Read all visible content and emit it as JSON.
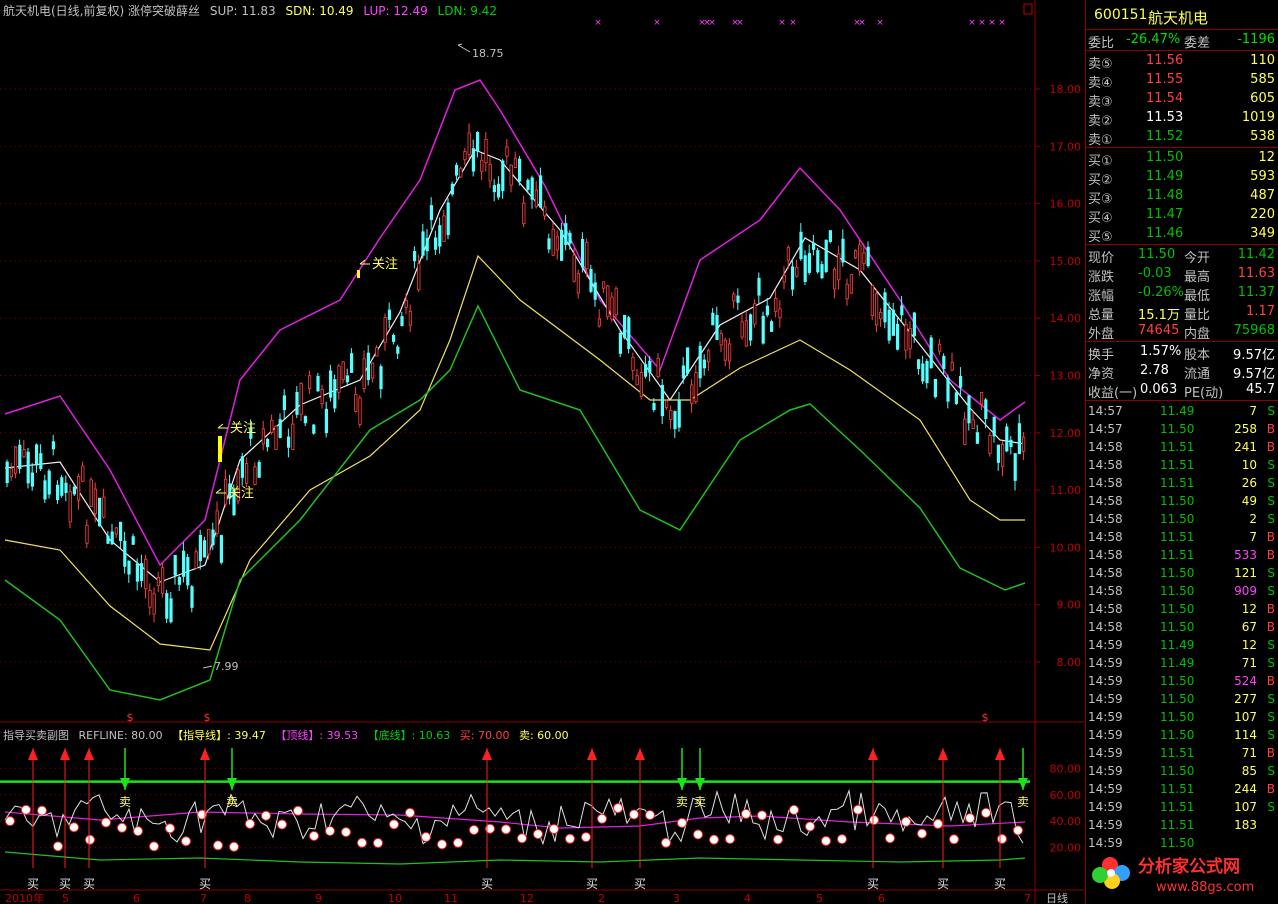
{
  "chart_header": {
    "title": "航天机电(日线,前复权) 涨停突破薛丝",
    "sup": "SUP: 11.83",
    "sdn": "SDN: 10.49",
    "lup": "LUP: 12.49",
    "ldn": "LDN: 9.42"
  },
  "sub_header": {
    "title": "指导买卖副图",
    "refline": "REFLINE: 80.00",
    "guide": "【指导线】: 39.47",
    "top": "【顶线】: 39.53",
    "bottom": "【底线】: 10.63",
    "buy": "买: 70.00",
    "sell": "卖: 60.00"
  },
  "price_axis": [
    "18.00",
    "17.00",
    "16.00",
    "15.00",
    "14.00",
    "13.00",
    "12.00",
    "11.00",
    "10.00",
    "9.00",
    "8.00"
  ],
  "sub_axis": [
    "80.00",
    "60.00",
    "40.00",
    "20.00"
  ],
  "annotations": {
    "high": "18.75",
    "low": "7.99",
    "watch": "关注",
    "buy": "买",
    "sell": "卖",
    "dollar": "$"
  },
  "date_axis": [
    "2010年",
    "5",
    "6",
    "7",
    "8",
    "9",
    "10",
    "11",
    "12",
    "2",
    "3",
    "4",
    "5",
    "6",
    "7"
  ],
  "period_tab": "日线",
  "stock": {
    "code": "600151",
    "name": "航天机电",
    "weibi_label": "委比",
    "weibi": "-26.47%",
    "weicha_label": "委差",
    "weicha": "-1196"
  },
  "asks": [
    {
      "label": "卖⑤",
      "price": "11.56",
      "vol": "110"
    },
    {
      "label": "卖④",
      "price": "11.55",
      "vol": "585"
    },
    {
      "label": "卖③",
      "price": "11.54",
      "vol": "605"
    },
    {
      "label": "卖②",
      "price": "11.53",
      "vol": "1019"
    },
    {
      "label": "卖①",
      "price": "11.52",
      "vol": "538"
    }
  ],
  "bids": [
    {
      "label": "买①",
      "price": "11.50",
      "vol": "12"
    },
    {
      "label": "买②",
      "price": "11.49",
      "vol": "593"
    },
    {
      "label": "买③",
      "price": "11.48",
      "vol": "487"
    },
    {
      "label": "买④",
      "price": "11.47",
      "vol": "220"
    },
    {
      "label": "买⑤",
      "price": "11.46",
      "vol": "349"
    }
  ],
  "quote": [
    {
      "l1": "现价",
      "v1": "11.50",
      "l2": "今开",
      "v2": "11.42"
    },
    {
      "l1": "涨跌",
      "v1": "-0.03",
      "l2": "最高",
      "v2": "11.63"
    },
    {
      "l1": "涨幅",
      "v1": "-0.26%",
      "l2": "最低",
      "v2": "11.37"
    },
    {
      "l1": "总量",
      "v1": "15.1万",
      "l2": "量比",
      "v2": "1.17"
    },
    {
      "l1": "外盘",
      "v1": "74645",
      "l2": "内盘",
      "v2": "75968"
    }
  ],
  "fundamentals": [
    {
      "l1": "换手",
      "v1": "1.57%",
      "l2": "股本",
      "v2": "9.57亿"
    },
    {
      "l1": "净资",
      "v1": "2.78",
      "l2": "流通",
      "v2": "9.57亿"
    },
    {
      "l1": "收益(一)",
      "v1": "0.063",
      "l2": "PE(动)",
      "v2": "45.7"
    }
  ],
  "ticks": [
    {
      "t": "14:57",
      "p": "11.49",
      "v": "7",
      "s": "S"
    },
    {
      "t": "14:57",
      "p": "11.50",
      "v": "258",
      "s": "B"
    },
    {
      "t": "14:58",
      "p": "11.51",
      "v": "241",
      "s": "B"
    },
    {
      "t": "14:58",
      "p": "11.51",
      "v": "10",
      "s": "S"
    },
    {
      "t": "14:58",
      "p": "11.51",
      "v": "26",
      "s": "S"
    },
    {
      "t": "14:58",
      "p": "11.50",
      "v": "49",
      "s": "S"
    },
    {
      "t": "14:58",
      "p": "11.50",
      "v": "2",
      "s": "S"
    },
    {
      "t": "14:58",
      "p": "11.51",
      "v": "7",
      "s": "B"
    },
    {
      "t": "14:58",
      "p": "11.51",
      "v": "533",
      "s": "B"
    },
    {
      "t": "14:58",
      "p": "11.50",
      "v": "121",
      "s": "S"
    },
    {
      "t": "14:58",
      "p": "11.50",
      "v": "909",
      "s": "S"
    },
    {
      "t": "14:58",
      "p": "11.50",
      "v": "12",
      "s": "B"
    },
    {
      "t": "14:58",
      "p": "11.50",
      "v": "67",
      "s": "B"
    },
    {
      "t": "14:59",
      "p": "11.49",
      "v": "12",
      "s": "S"
    },
    {
      "t": "14:59",
      "p": "11.49",
      "v": "71",
      "s": "S"
    },
    {
      "t": "14:59",
      "p": "11.50",
      "v": "524",
      "s": "B"
    },
    {
      "t": "14:59",
      "p": "11.50",
      "v": "277",
      "s": "S"
    },
    {
      "t": "14:59",
      "p": "11.50",
      "v": "107",
      "s": "S"
    },
    {
      "t": "14:59",
      "p": "11.50",
      "v": "114",
      "s": "S"
    },
    {
      "t": "14:59",
      "p": "11.51",
      "v": "71",
      "s": "B"
    },
    {
      "t": "14:59",
      "p": "11.50",
      "v": "85",
      "s": "S"
    },
    {
      "t": "14:59",
      "p": "11.51",
      "v": "244",
      "s": "B"
    },
    {
      "t": "14:59",
      "p": "11.51",
      "v": "107",
      "s": "S"
    },
    {
      "t": "14:59",
      "p": "11.51",
      "v": "183",
      "s": ""
    },
    {
      "t": "14:59",
      "p": "11.50",
      "v": "",
      "s": ""
    }
  ],
  "colors": {
    "up": "#ff4040",
    "down": "#54ffff",
    "green": "#00c000",
    "label": "#c0c0c0",
    "accent": "#ffff54",
    "magenta": "#ff00ff",
    "flat": "#ffffff"
  }
}
